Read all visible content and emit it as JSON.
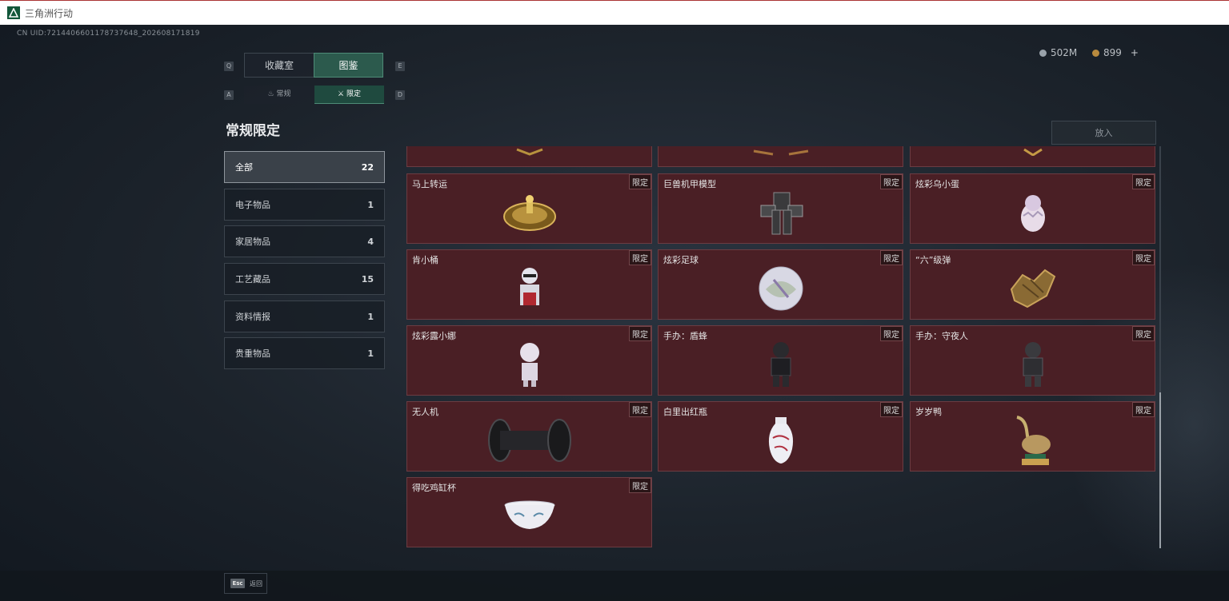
{
  "window": {
    "title": "三角洲行动",
    "accent": "#12573a"
  },
  "header": {
    "uid": "CN UID:7214406601178737648_202608171819",
    "currency": [
      {
        "icon": "silver-coin-icon",
        "value": "502M"
      },
      {
        "icon": "gold-coin-icon",
        "value": "899"
      }
    ],
    "add_label": "+"
  },
  "tabs": [
    {
      "key": "Q",
      "label": "收藏室",
      "active": false
    },
    {
      "key": "E",
      "label": "图鉴",
      "active": true
    }
  ],
  "tab_keys_right": "E",
  "subtabs": [
    {
      "key": "A",
      "icon": "fire-icon",
      "icon_glyph": "♨",
      "label": "常规",
      "active": false
    },
    {
      "key": "D",
      "icon": "crossed-swords-icon",
      "icon_glyph": "⚔",
      "label": "限定",
      "active": true
    }
  ],
  "section_title": "常规限定",
  "categories": [
    {
      "label": "全部",
      "count": "22",
      "active": true
    },
    {
      "label": "电子物品",
      "count": "1",
      "active": false
    },
    {
      "label": "家居物品",
      "count": "4",
      "active": false
    },
    {
      "label": "工艺藏品",
      "count": "15",
      "active": false
    },
    {
      "label": "资料情报",
      "count": "1",
      "active": false
    },
    {
      "label": "贵重物品",
      "count": "1",
      "active": false
    }
  ],
  "put_button": "放入",
  "badge_label": "限定",
  "items": [
    {
      "name": "",
      "icon": "gold-item-icon",
      "partial": true
    },
    {
      "name": "",
      "icon": "gold-item-icon",
      "partial": true
    },
    {
      "name": "",
      "icon": "gold-item-icon",
      "partial": true
    },
    {
      "name": "马上转运",
      "icon": "golden-compass-icon"
    },
    {
      "name": "巨兽机甲模型",
      "icon": "mech-model-icon"
    },
    {
      "name": "炫彩乌小蛋",
      "icon": "hatching-egg-icon"
    },
    {
      "name": "肯小桶",
      "icon": "figurine-icon"
    },
    {
      "name": "炫彩足球",
      "icon": "soccer-ball-icon"
    },
    {
      "name": "“六”级弹",
      "icon": "golden-hand-icon"
    },
    {
      "name": "炫彩露小娜",
      "icon": "doll-figure-icon"
    },
    {
      "name": "手办：盾蜂",
      "icon": "soldier-figure-icon"
    },
    {
      "name": "手办：守夜人",
      "icon": "soldier-figure-icon"
    },
    {
      "name": "无人机",
      "icon": "drone-roller-icon"
    },
    {
      "name": "白里出红瓶",
      "icon": "porcelain-vase-icon"
    },
    {
      "name": "岁岁鸭",
      "icon": "duck-statue-icon"
    },
    {
      "name": "得吃鸡缸杯",
      "icon": "porcelain-bowl-icon"
    }
  ],
  "footer": {
    "key": "Esc",
    "label": "返回"
  }
}
